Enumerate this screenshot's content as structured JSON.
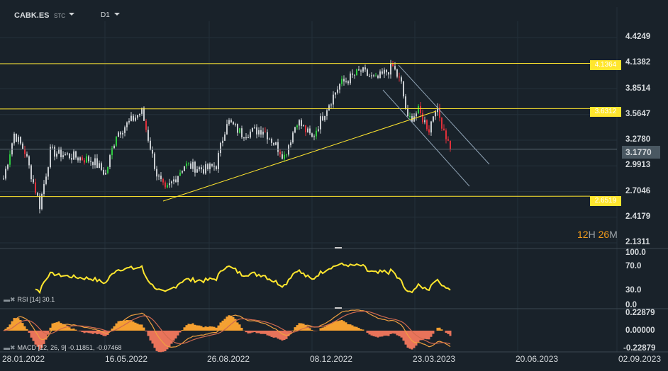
{
  "header": {
    "symbol": "CABK.ES",
    "type": "STC",
    "timeframe": "D1"
  },
  "price_axis": [
    "4.4249",
    "4.1382",
    "3.8514",
    "3.5647",
    "3.2780",
    "2.9913",
    "2.7046",
    "2.4179",
    "2.1311"
  ],
  "levels": [
    {
      "value": "4.1364"
    },
    {
      "value": "3.6312"
    },
    {
      "value": "2.6519"
    }
  ],
  "current_price": "3.1770",
  "timer": {
    "h": "12",
    "h_unit": "H",
    "m": "26",
    "m_unit": "M"
  },
  "rsi": {
    "label": "RSI",
    "params": "[14]",
    "value": "30.1",
    "axis": [
      "100.0",
      "70.0",
      "30.0",
      "0.0"
    ]
  },
  "macd": {
    "label": "MACD",
    "params": "[12, 26, 9]",
    "values": "-0.11851,  -0.07468",
    "axis": [
      "0.22879",
      "0.00000",
      "-0.22879"
    ]
  },
  "dates": [
    "28.01.2022",
    "16.05.2022",
    "26.08.2022",
    "08.12.2022",
    "23.03.2023",
    "20.06.2023",
    "02.09.2023"
  ],
  "colors": {
    "up": "#2ecc40",
    "down": "#e0303a",
    "neutral": "#c8ccd0",
    "level": "#ffe62e",
    "rsi": "#ffe62e",
    "macd_pos": "#f5a030",
    "macd_neg": "#e8735a"
  },
  "chart_data": {
    "type": "candlestick",
    "price_path": [
      [
        0,
        2.85
      ],
      [
        5,
        3.35
      ],
      [
        10,
        3.15
      ],
      [
        17,
        2.55
      ],
      [
        22,
        3.15
      ],
      [
        32,
        3.1
      ],
      [
        42,
        3.05
      ],
      [
        48,
        2.9
      ],
      [
        53,
        3.35
      ],
      [
        65,
        3.6
      ],
      [
        72,
        2.9
      ],
      [
        76,
        2.7
      ],
      [
        85,
        3.0
      ],
      [
        95,
        2.95
      ],
      [
        100,
        3.0
      ],
      [
        105,
        3.5
      ],
      [
        112,
        3.35
      ],
      [
        122,
        3.4
      ],
      [
        132,
        3.1
      ],
      [
        138,
        3.5
      ],
      [
        145,
        3.3
      ],
      [
        152,
        3.65
      ],
      [
        158,
        3.9
      ],
      [
        168,
        4.05
      ],
      [
        175,
        3.95
      ],
      [
        183,
        4.1
      ],
      [
        187,
        3.9
      ],
      [
        190,
        3.5
      ],
      [
        195,
        3.6
      ],
      [
        200,
        3.4
      ],
      [
        203,
        3.65
      ],
      [
        207,
        3.4
      ],
      [
        210,
        3.18
      ]
    ]
  }
}
